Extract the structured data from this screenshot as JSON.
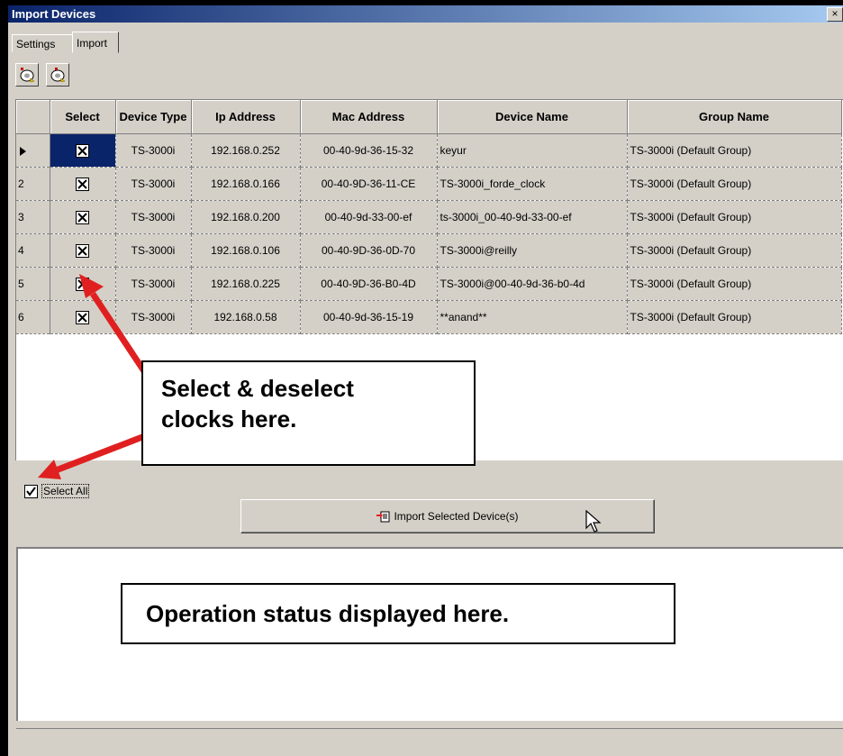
{
  "window": {
    "title": "Import Devices",
    "close_glyph": "×"
  },
  "tabs": [
    {
      "label": "Settings",
      "active": false
    },
    {
      "label": "Import",
      "active": true
    }
  ],
  "toolbar": {
    "buttons": [
      {
        "icon": "add-device-icon"
      },
      {
        "icon": "remove-device-icon"
      }
    ]
  },
  "grid": {
    "columns": [
      "",
      "Select",
      "Device Type",
      "Ip Address",
      "Mac Address",
      "Device Name",
      "Group Name"
    ],
    "rows": [
      {
        "row": "",
        "selected": true,
        "type": "TS-3000i",
        "ip": "192.168.0.252",
        "mac": "00-40-9d-36-15-32",
        "name": "keyur",
        "group": "TS-3000i (Default Group)"
      },
      {
        "row": "2",
        "selected": true,
        "type": "TS-3000i",
        "ip": "192.168.0.166",
        "mac": "00-40-9D-36-11-CE",
        "name": "TS-3000i_forde_clock",
        "group": "TS-3000i (Default Group)"
      },
      {
        "row": "3",
        "selected": true,
        "type": "TS-3000i",
        "ip": "192.168.0.200",
        "mac": "00-40-9d-33-00-ef",
        "name": "ts-3000i_00-40-9d-33-00-ef",
        "group": "TS-3000i (Default Group)"
      },
      {
        "row": "4",
        "selected": true,
        "type": "TS-3000i",
        "ip": "192.168.0.106",
        "mac": "00-40-9D-36-0D-70",
        "name": "TS-3000i@reilly",
        "group": "TS-3000i (Default Group)"
      },
      {
        "row": "5",
        "selected": true,
        "type": "TS-3000i",
        "ip": "192.168.0.225",
        "mac": "00-40-9D-36-B0-4D",
        "name": "TS-3000i@00-40-9d-36-b0-4d",
        "group": "TS-3000i (Default Group)"
      },
      {
        "row": "6",
        "selected": true,
        "type": "TS-3000i",
        "ip": "192.168.0.58",
        "mac": "00-40-9d-36-15-19",
        "name": "**anand**",
        "group": "TS-3000i (Default Group)"
      }
    ]
  },
  "select_all": {
    "label": "Select All",
    "checked": true
  },
  "import_button": {
    "label": "Import Selected Device(s)"
  },
  "callouts": {
    "select": [
      "Select & deselect",
      "clocks here."
    ],
    "status": "Operation status displayed here."
  },
  "colors": {
    "title_start": "#0a246a",
    "title_end": "#a6caf0",
    "face": "#d4d0c8",
    "arrow": "#e02020"
  }
}
